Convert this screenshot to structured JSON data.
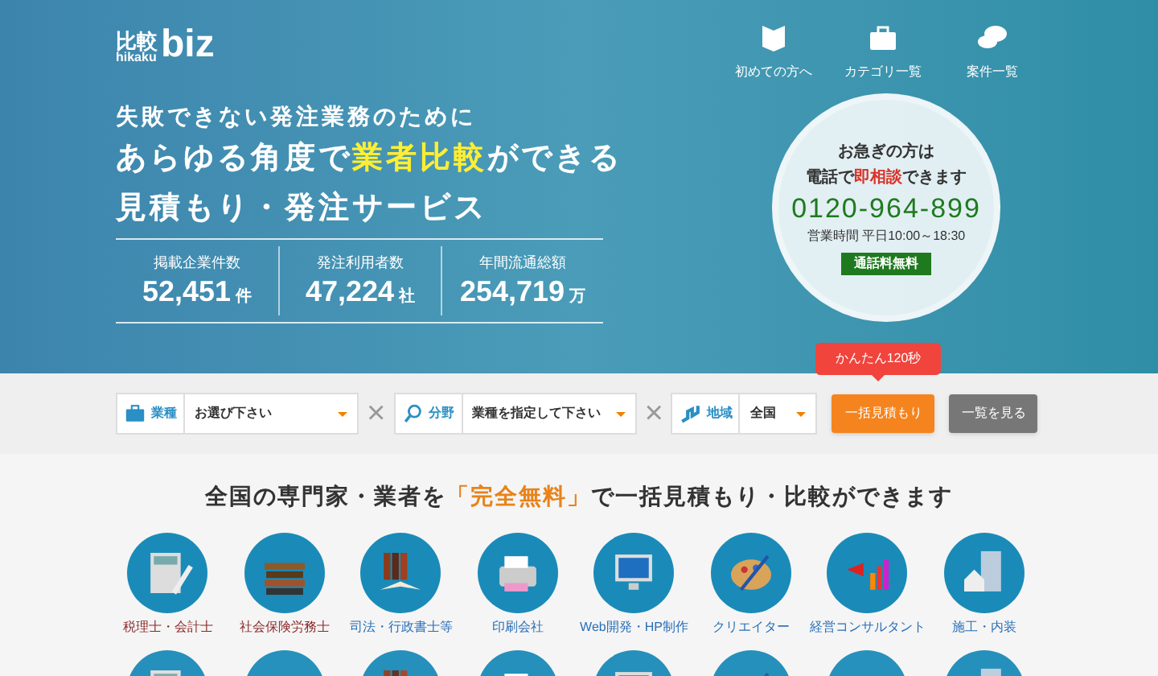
{
  "logo": {
    "main": "比較",
    "sub": "hikaku",
    "brand": "biz"
  },
  "nav": [
    {
      "label": "初めての方へ",
      "kind": "book"
    },
    {
      "label": "カテゴリ一覧",
      "kind": "case"
    },
    {
      "label": "案件一覧",
      "kind": "chat"
    }
  ],
  "headline": {
    "lead": "失敗できない発注業務のために",
    "main": "あらゆる角度で**業者比較**ができる",
    "sub": "見積もり・発注サービス"
  },
  "stats": [
    {
      "label": "掲載企業件数",
      "value": "52,451",
      "unit": "件"
    },
    {
      "label": "発注利用者数",
      "value": "47,224",
      "unit": "社"
    },
    {
      "label": "年間流通総額",
      "value": "254,719",
      "unit": "万"
    }
  ],
  "contact": {
    "line1": "お急ぎの方は",
    "line2": "電話で**即相談**できます",
    "phone": "0120-964-899",
    "hours": "営業時間 平日10:00～18:30",
    "badge": "通話料無料"
  },
  "search": {
    "fields": [
      {
        "label": "業種",
        "value": "お選び下さい",
        "kind": "case"
      },
      {
        "label": "分野",
        "value": "業種を指定して下さい",
        "kind": "search"
      },
      {
        "label": "地域",
        "value": "全国",
        "kind": "map"
      }
    ],
    "separator": "×",
    "tooltip": "かんたん120秒",
    "primary_button": "一括見積もり",
    "secondary_button": "一覧を見る"
  },
  "section_title": {
    "before": "全国の専門家・業者を",
    "highlight": "「完全無料」",
    "after": "で一括見積もり・比較ができます"
  },
  "categories": [
    {
      "label": "税理士・会計士",
      "visited": true
    },
    {
      "label": "社会保険労務士",
      "visited": true
    },
    {
      "label": "司法・行政書士等",
      "visited": false
    },
    {
      "label": "印刷会社",
      "visited": false
    },
    {
      "label": "Web開発・HP制作",
      "visited": false
    },
    {
      "label": "クリエイター",
      "visited": false
    },
    {
      "label": "経営コンサルタント",
      "visited": false
    },
    {
      "label": "施工・内装",
      "visited": false
    },
    {
      "kind": "partial"
    },
    {
      "kind": "partial"
    },
    {
      "kind": "partial"
    },
    {
      "kind": "partial"
    },
    {
      "kind": "partial"
    },
    {
      "kind": "partial"
    },
    {
      "kind": "partial"
    },
    {
      "kind": "partial"
    }
  ]
}
